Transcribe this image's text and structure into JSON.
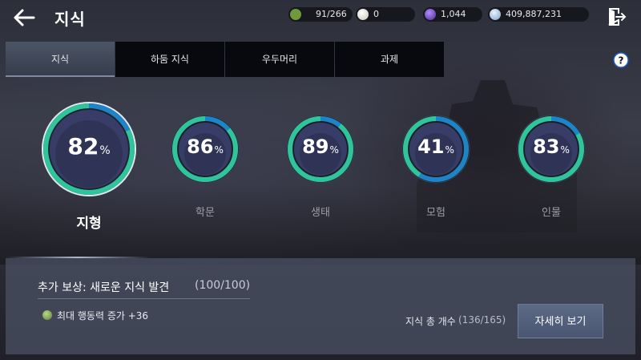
{
  "header": {
    "title": "지식",
    "resources": [
      {
        "icon": "action-point-icon",
        "value": "91/266",
        "color": "#6f9a3c"
      },
      {
        "icon": "pearl-icon",
        "value": "0",
        "color": "#d8d2c8"
      },
      {
        "icon": "purple-orb-icon",
        "value": "1,044",
        "color": "#6a3fb0"
      },
      {
        "icon": "silver-coin-icon",
        "value": "409,887,231",
        "color": "#9ab6d8"
      }
    ]
  },
  "tabs": [
    {
      "label": "지식",
      "active": true
    },
    {
      "label": "하둠 지식",
      "active": false
    },
    {
      "label": "우두머리",
      "active": false
    },
    {
      "label": "과제",
      "active": false
    }
  ],
  "categories": [
    {
      "label": "지형",
      "percent": "82",
      "progress": 0.82,
      "selected": true
    },
    {
      "label": "학문",
      "percent": "86",
      "progress": 0.86,
      "selected": false
    },
    {
      "label": "생태",
      "percent": "89",
      "progress": 0.89,
      "selected": false
    },
    {
      "label": "모험",
      "percent": "41",
      "progress": 0.41,
      "selected": false
    },
    {
      "label": "인물",
      "percent": "83",
      "progress": 0.83,
      "selected": false
    }
  ],
  "percent_symbol": "%",
  "reward": {
    "title": "추가 보상: 새로운 지식 발견",
    "count": "(100/100)",
    "effect": "최대 행동력 증가 +36"
  },
  "total": {
    "label": "지식 총 개수",
    "count": "(136/165)"
  },
  "detail_button": "자세히 보기",
  "colors": {
    "ring_green": "#2fc49a",
    "ring_blue": "#1e8fd8",
    "active_tab": "#4c5566"
  }
}
